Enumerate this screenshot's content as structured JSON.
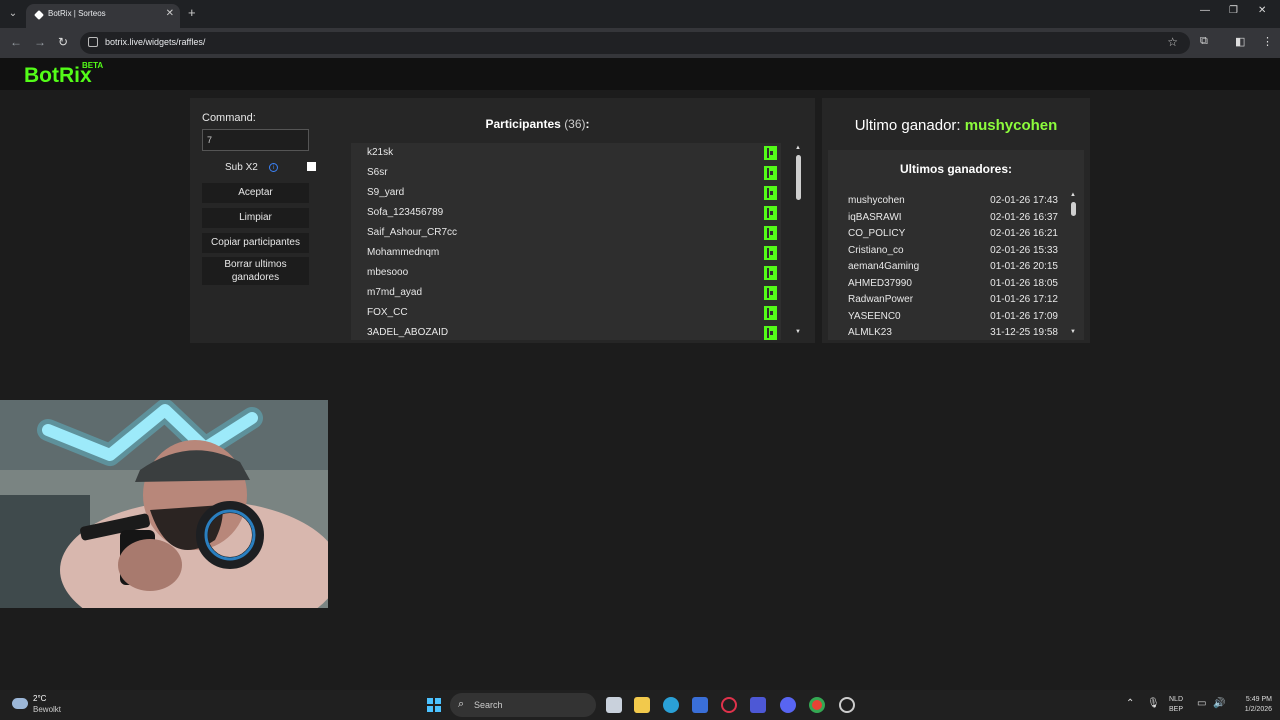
{
  "browser": {
    "tab_title": "BotRix | Sorteos",
    "url": "botrix.live/widgets/raffles/"
  },
  "brand": {
    "name": "BotRix",
    "badge": "BETA"
  },
  "controls": {
    "command_label": "Command:",
    "command_value": "7",
    "sub_label": "Sub X2",
    "accept": "Aceptar",
    "clear": "Limpiar",
    "copy": "Copiar participantes",
    "delete_winners": "Borrar ultimos ganadores"
  },
  "participants": {
    "title": "Participantes",
    "count": "(36)",
    "colon": ":",
    "items": [
      "k21sk",
      "S6sr",
      "S9_yard",
      "Sofa_123456789",
      "Saif_Ashour_CR7cc",
      "Mohammednqm",
      "mbesooo",
      "m7md_ayad",
      "FOX_CC",
      "3ADEL_ABOZAID"
    ]
  },
  "last_winner": {
    "label": "Ultimo ganador:",
    "name": "mushycohen"
  },
  "winners": {
    "title": "Ultimos ganadores:",
    "items": [
      {
        "name": "mushycohen",
        "date": "02-01-26 17:43"
      },
      {
        "name": "iqBASRAWI",
        "date": "02-01-26 16:37"
      },
      {
        "name": "CO_POLICY",
        "date": "02-01-26 16:21"
      },
      {
        "name": "Cristiano_co",
        "date": "02-01-26 15:33"
      },
      {
        "name": "aeman4Gaming",
        "date": "01-01-26 20:15"
      },
      {
        "name": "AHMED37990",
        "date": "01-01-26 18:05"
      },
      {
        "name": "RadwanPower",
        "date": "01-01-26 17:12"
      },
      {
        "name": "YASEENC0",
        "date": "01-01-26 17:09"
      },
      {
        "name": "ALMLK23",
        "date": "31-12-25 19:58"
      }
    ]
  },
  "taskbar": {
    "temp": "2°C",
    "weather": "Bewolkt",
    "search": "Search",
    "lang_top": "NLD",
    "lang_bottom": "BEP",
    "time": "5:49 PM",
    "date": "1/2/2026"
  },
  "colors": {
    "accent": "#53fc18",
    "winner": "#8cfc3c"
  }
}
